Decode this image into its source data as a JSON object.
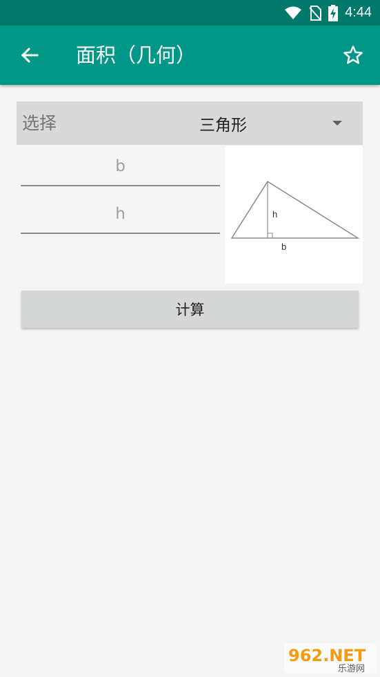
{
  "status_bar": {
    "time": "4:44"
  },
  "app_bar": {
    "title": "面积（几何）"
  },
  "spinner": {
    "label": "选择",
    "selected": "三角形"
  },
  "inputs": {
    "b_placeholder": "b",
    "h_placeholder": "h"
  },
  "diagram": {
    "height_label": "h",
    "base_label": "b"
  },
  "calculate_label": "计算",
  "watermark": {
    "site": "962.NET",
    "brand": "乐游网"
  },
  "colors": {
    "status_bar": "#00796b",
    "app_bar": "#009688",
    "button": "#d6d7d7"
  }
}
